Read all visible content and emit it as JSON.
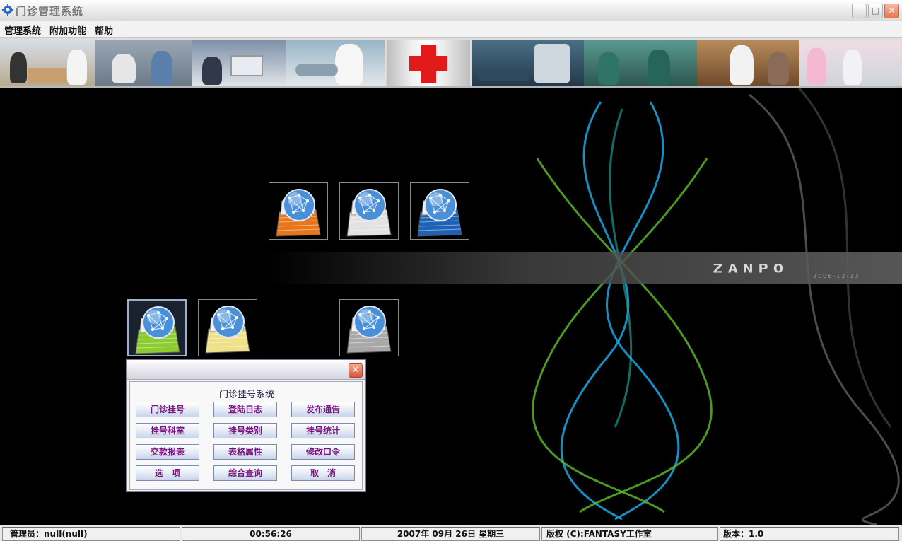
{
  "window": {
    "title": "门诊管理系统"
  },
  "menu": {
    "items": [
      "管理系统",
      "附加功能",
      "帮助"
    ]
  },
  "brand": {
    "name": "ZANPO",
    "sub": "2006-12-13"
  },
  "dialog": {
    "title": "门诊挂号系统",
    "buttons": [
      [
        "门诊挂号",
        "登陆日志",
        "发布通告"
      ],
      [
        "挂号科室",
        "挂号类别",
        "挂号统计"
      ],
      [
        "交款报表",
        "表格属性",
        "修改口令"
      ],
      [
        "选　项",
        "综合查询",
        "取　消"
      ]
    ]
  },
  "status": {
    "admin": "管理员：null(null)",
    "time": "00:56:26",
    "date": "2007年 09月 26日 星期三",
    "copyright": "版权 (C):FANTASY工作室",
    "version": "版本：1.0"
  },
  "tiles": [
    {
      "icon": "globe-document-orange-icon",
      "color": "#e8751a"
    },
    {
      "icon": "globe-document-white-icon",
      "color": "#e2e2e2"
    },
    {
      "icon": "globe-document-blue-icon",
      "color": "#1e62b8"
    },
    {
      "icon": "globe-document-green-icon",
      "color": "#8ccc2e"
    },
    {
      "icon": "globe-document-yellow-icon",
      "color": "#efe08a"
    },
    {
      "icon": "globe-document-gray-icon",
      "color": "#a8a8a8"
    }
  ],
  "colors": {
    "accent_text": "#7a1480",
    "background": "#000000"
  }
}
